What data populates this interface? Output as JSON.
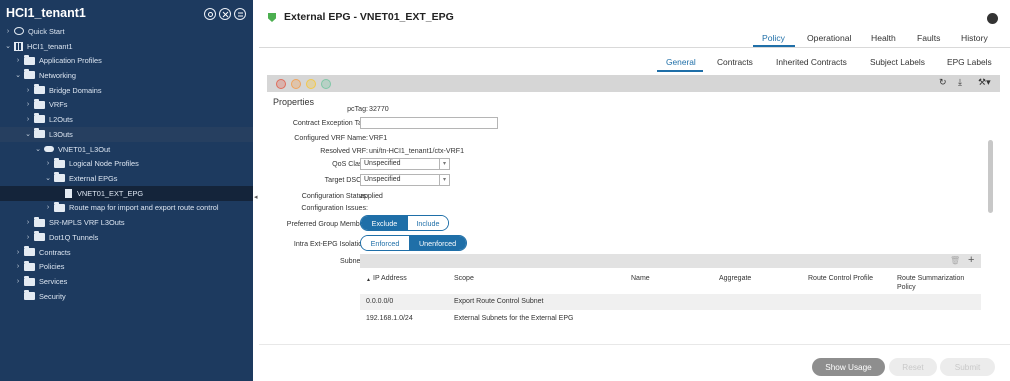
{
  "sidebar": {
    "title": "HCI1_tenant1",
    "icons": [
      "home-ring-icon",
      "crossed-badge-icon",
      "swap-icon"
    ],
    "items": [
      {
        "label": "Quick Start"
      },
      {
        "label": "HCI1_tenant1"
      },
      {
        "label": "Application Profiles"
      },
      {
        "label": "Networking"
      },
      {
        "label": "Bridge Domains"
      },
      {
        "label": "VRFs"
      },
      {
        "label": "L2Outs"
      },
      {
        "label": "L3Outs"
      },
      {
        "label": "VNET01_L3Out"
      },
      {
        "label": "Logical Node Profiles"
      },
      {
        "label": "External EPGs"
      },
      {
        "label": "VNET01_EXT_EPG"
      },
      {
        "label": "Route map for import and export route control"
      },
      {
        "label": "SR-MPLS VRF L3Outs"
      },
      {
        "label": "Dot1Q Tunnels"
      },
      {
        "label": "Contracts"
      },
      {
        "label": "Policies"
      },
      {
        "label": "Services"
      },
      {
        "label": "Security"
      }
    ]
  },
  "header": {
    "title": "External EPG - VNET01_EXT_EPG",
    "tabs": [
      {
        "label": "Policy"
      },
      {
        "label": "Operational"
      },
      {
        "label": "Health"
      },
      {
        "label": "Faults"
      },
      {
        "label": "History"
      }
    ],
    "subtabs": [
      {
        "label": "General"
      },
      {
        "label": "Contracts"
      },
      {
        "label": "Inherited Contracts"
      },
      {
        "label": "Subject Labels"
      },
      {
        "label": "EPG Labels"
      }
    ]
  },
  "toolbar": {
    "status_colors": [
      "#e06c5a",
      "#f0a35a",
      "#f3c84b",
      "#7fc7a6"
    ],
    "actions": {
      "refresh": "↻",
      "download": "⤓",
      "tools": "⚒▾"
    }
  },
  "properties": {
    "heading": "Properties",
    "pctag_label": "pcTag:",
    "pctag_value": "32770",
    "contract_exception_tag_label": "Contract Exception Tag:",
    "contract_exception_tag_value": "",
    "configured_vrf_label": "Configured VRF Name:",
    "configured_vrf_value": "VRF1",
    "resolved_vrf_label": "Resolved VRF:",
    "resolved_vrf_value": "uni/tn-HCI1_tenant1/ctx-VRF1",
    "qos_class_label": "QoS Class:",
    "qos_class_value": "Unspecified",
    "target_dscp_label": "Target DSCP:",
    "target_dscp_value": "Unspecified",
    "config_status_label": "Configuration Status:",
    "config_status_value": "applied",
    "config_issues_label": "Configuration Issues:",
    "config_issues_value": "",
    "preferred_group_label": "Preferred Group Member:",
    "preferred_group_options": [
      "Exclude",
      "Include"
    ],
    "preferred_group_selected": "Exclude",
    "intra_isolation_label": "Intra Ext-EPG Isolation:",
    "intra_isolation_options": [
      "Enforced",
      "Unenforced"
    ],
    "intra_isolation_selected": "Unenforced",
    "subnets_label": "Subnets:"
  },
  "subnets": {
    "columns": [
      "IP Address",
      "Scope",
      "Name",
      "Aggregate",
      "Route Control Profile",
      "Route Summarization Policy"
    ],
    "sort_indicator": "▲",
    "rows": [
      {
        "ip": "0.0.0.0/0",
        "scope": "Export Route Control Subnet"
      },
      {
        "ip": "192.168.1.0/24",
        "scope": "External Subnets for the External EPG"
      }
    ]
  },
  "footer": {
    "show_usage": "Show Usage",
    "reset": "Reset",
    "submit": "Submit"
  }
}
